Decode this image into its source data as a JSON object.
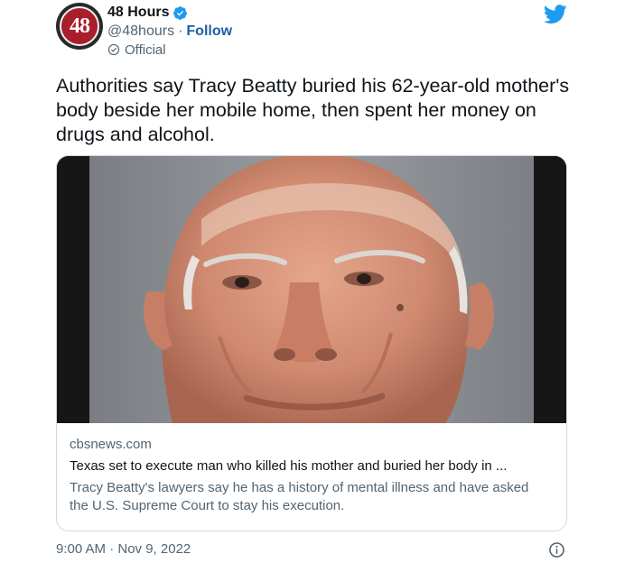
{
  "account": {
    "display_name": "48 Hours",
    "avatar_text": "48",
    "handle": "@48hours",
    "separator": "·",
    "follow_label": "Follow",
    "official_label": "Official",
    "verified_icon": "verified-badge-icon",
    "brand_color": "#1d9bf0"
  },
  "tweet": {
    "text": "Authorities say Tracy Beatty buried his 62-year-old mother's body beside her mobile home, then spent her money on drugs and alcohol.",
    "timestamp": "9:00 AM · Nov 9, 2022"
  },
  "card": {
    "domain": "cbsnews.com",
    "title": "Texas set to execute man who killed his mother and buried her body in ...",
    "description": "Tracy Beatty's lawyers say he has a history of mental illness and have asked the U.S. Supreme Court to stay his execution.",
    "image_icon": "mugshot-photo"
  },
  "icons": {
    "logo": "twitter-bird-icon",
    "info": "info-icon",
    "official": "official-badge-icon"
  }
}
